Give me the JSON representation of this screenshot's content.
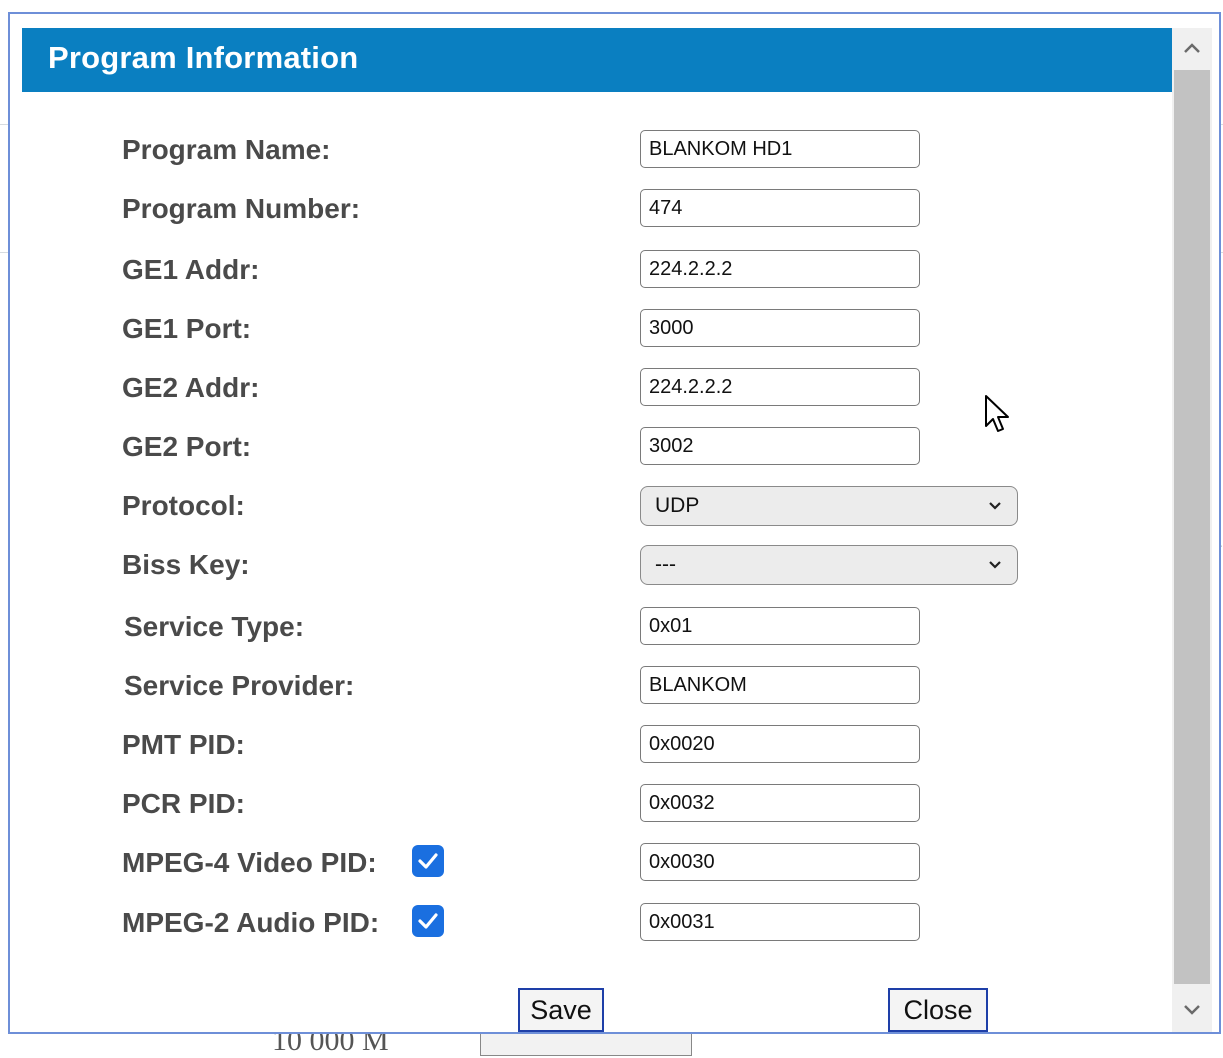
{
  "dialog": {
    "title": "Program Information",
    "fields": {
      "program_name": {
        "label": "Program Name:",
        "value": "BLANKOM HD1"
      },
      "program_number": {
        "label": "Program Number:",
        "value": "474"
      },
      "ge1_addr": {
        "label": "GE1 Addr:",
        "value": "224.2.2.2"
      },
      "ge1_port": {
        "label": "GE1 Port:",
        "value": "3000"
      },
      "ge2_addr": {
        "label": "GE2 Addr:",
        "value": "224.2.2.2"
      },
      "ge2_port": {
        "label": "GE2 Port:",
        "value": "3002"
      },
      "protocol": {
        "label": "Protocol:",
        "selected": "UDP"
      },
      "biss_key": {
        "label": "Biss Key:",
        "selected": "---"
      },
      "service_type": {
        "label": "Service Type:",
        "value": "0x01"
      },
      "service_provider": {
        "label": "Service Provider:",
        "value": "BLANKOM"
      },
      "pmt_pid": {
        "label": "PMT PID:",
        "value": "0x0020"
      },
      "pcr_pid": {
        "label": "PCR PID:",
        "value": "0x0032"
      },
      "mpeg4_video_pid": {
        "label": "MPEG-4 Video PID:",
        "value": "0x0030",
        "checked": true
      },
      "mpeg2_audio_pid": {
        "label": "MPEG-2 Audio PID:",
        "value": "0x0031",
        "checked": true
      }
    },
    "buttons": {
      "save_label": "Save",
      "close_label": "Close"
    }
  },
  "background": {
    "peek_text": "10 000 M"
  },
  "colors": {
    "title_bar": "#0a7fc1",
    "checkbox": "#1a6fe0",
    "button_border": "#1e3fa8"
  },
  "icons": {
    "checkbox": "check-icon",
    "select": "chevron-down-icon",
    "scroll_up": "chevron-up-icon",
    "scroll_down": "chevron-down-icon",
    "cursor": "mouse-pointer-icon"
  }
}
